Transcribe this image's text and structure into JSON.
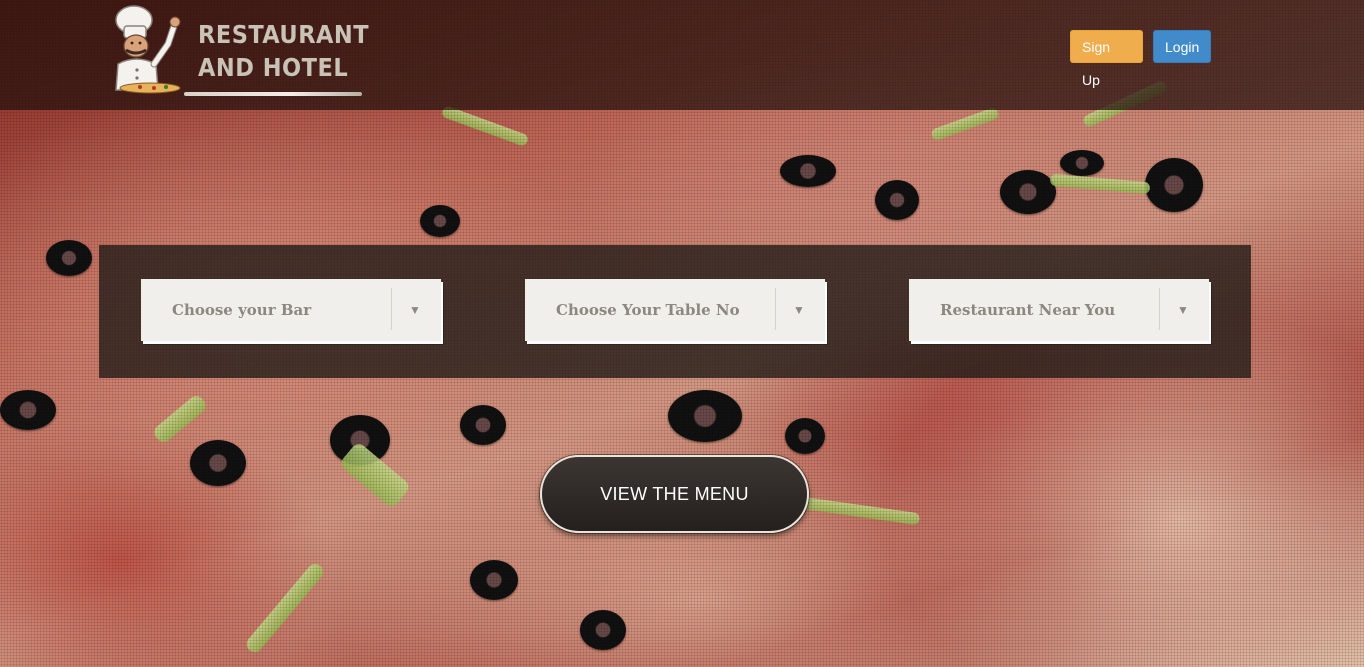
{
  "brand": {
    "line1": "RESTAURANT",
    "line2": "AND HOTEL",
    "logo_icon": "chef-icon"
  },
  "header": {
    "signup_label": "Sign Up",
    "login_label": "Login",
    "colors": {
      "signup": "#f0ad4e",
      "login": "#428bca"
    }
  },
  "search": {
    "selects": [
      {
        "label": "Choose your Bar",
        "arrow_icon": "caret-down-icon"
      },
      {
        "label": "Choose Your Table No",
        "arrow_icon": "caret-down-icon"
      },
      {
        "label": "Restaurant Near You",
        "arrow_icon": "caret-down-icon"
      }
    ]
  },
  "cta": {
    "label": "VIEW THE MENU"
  },
  "arrow_glyph": "▼"
}
